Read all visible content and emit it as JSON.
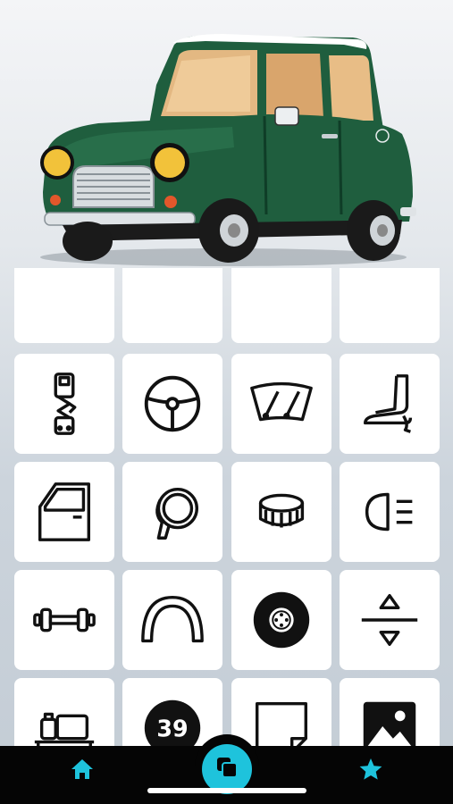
{
  "hero": {
    "image": "green-mini-cooper-illustration"
  },
  "colors": {
    "accent": "#1ec3dc",
    "car_body": "#1f5e3e",
    "tile_bg": "#ffffff",
    "icon": "#111111",
    "tabbar": "#050505"
  },
  "parts": [
    {
      "icon": "seatbelt-icon"
    },
    {
      "icon": "steering-wheel-icon"
    },
    {
      "icon": "windshield-wiper-icon"
    },
    {
      "icon": "seat-icon"
    },
    {
      "icon": "door-icon"
    },
    {
      "icon": "side-mirror-icon"
    },
    {
      "icon": "fuel-cap-icon"
    },
    {
      "icon": "fog-light-icon"
    },
    {
      "icon": "axle-icon"
    },
    {
      "icon": "wheel-arch-icon"
    },
    {
      "icon": "tire-icon"
    },
    {
      "icon": "suspension-height-icon"
    },
    {
      "icon": "roof-rack-luggage-icon"
    },
    {
      "icon": "racing-number-icon",
      "text": "39"
    },
    {
      "icon": "sticker-icon"
    },
    {
      "icon": "image-icon"
    }
  ],
  "tabbar": {
    "items": [
      {
        "icon": "home-icon"
      },
      {
        "icon": "gallery-icon"
      },
      {
        "icon": "star-icon"
      }
    ]
  }
}
